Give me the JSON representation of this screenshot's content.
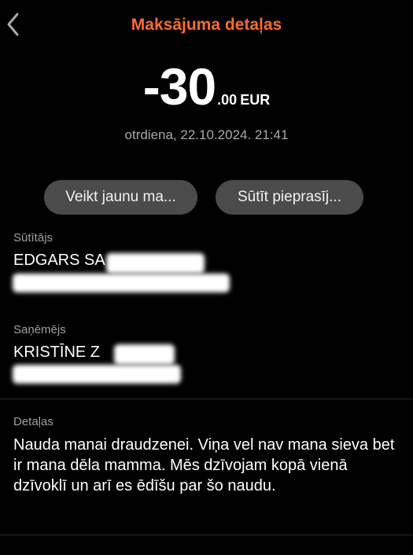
{
  "header": {
    "title": "Maksājuma detaļas",
    "back_icon": "chevron-left-icon"
  },
  "amount": {
    "main": "-30",
    "decimals": ".00",
    "currency": "EUR"
  },
  "datetime": "otrdiena, 22.10.2024. 21:41",
  "actions": {
    "new_payment": "Veikt jaunu ma...",
    "send_request": "Sūtīt pieprasīj..."
  },
  "sender": {
    "label": "Sūtītājs",
    "name": "EDGARS SA"
  },
  "recipient": {
    "label": "Saņēmējs",
    "name": "KRISTĪNE Z"
  },
  "details": {
    "label": "Detaļas",
    "text": "Nauda manai draudzenei. Viņa vel nav mana sieva bet ir mana dēla mamma. Mēs dzīvojam kopā vienā dzīvoklī un arī es ēdīšu par šo naudu."
  },
  "colors": {
    "accent": "#ff6a2b",
    "background": "#000000",
    "pill": "#4b4b4b"
  }
}
